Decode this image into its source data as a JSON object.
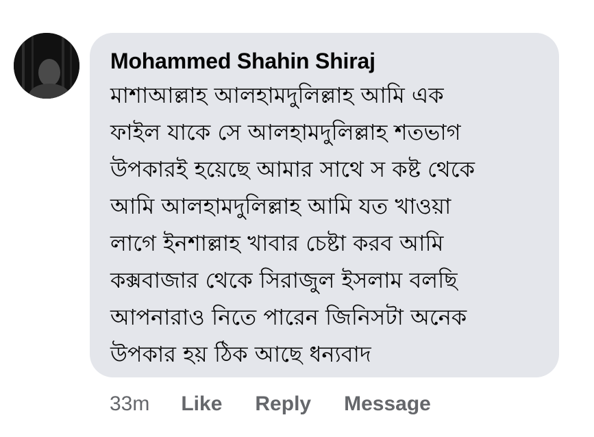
{
  "comment": {
    "author": "Mohammed Shahin Shiraj",
    "body_lines": [
      "মাশাআল্লাহ আলহামদুলিল্লাহ আমি এক",
      "ফাইল যাকে সে আলহামদুলিল্লাহ শতভাগ",
      "উপকারই হয়েছে আমার সাথে স কষ্ট থেকে",
      "আমি আলহামদুলিল্লাহ আমি যত খাওয়া",
      "লাগে ইনশাল্লাহ খাবার চেষ্টা করব আমি",
      "কক্সবাজার থেকে সিরাজুল ইসলাম বলছি",
      "আপনারাও নিতে পারেন জিনিসটা অনেক",
      "উপকার হয় ঠিক আছে ধন্যবাদ"
    ],
    "timestamp": "33m",
    "actions": {
      "like": "Like",
      "reply": "Reply",
      "message": "Message"
    }
  },
  "colors": {
    "bubble": "#e4e6eb",
    "text": "#050505",
    "secondary_text": "#65676b"
  },
  "icons": {
    "avatar": "profile-photo-avatar"
  }
}
